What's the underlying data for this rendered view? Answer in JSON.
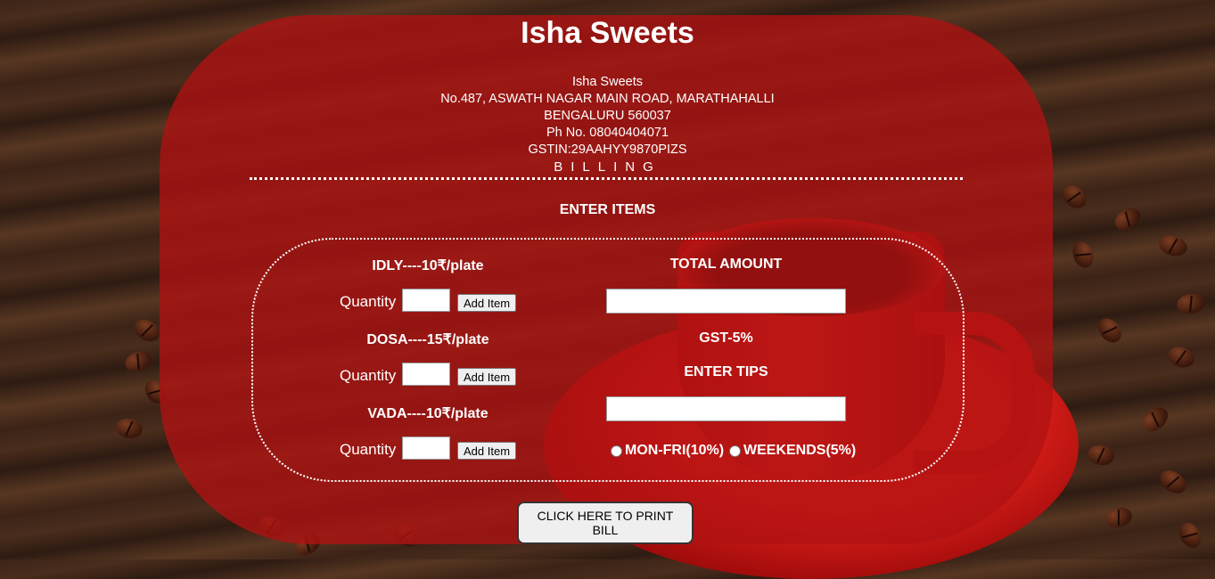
{
  "header": {
    "title": "Isha Sweets",
    "address_lines": [
      "Isha Sweets",
      "No.487, ASWATH NAGAR MAIN ROAD, MARATHAHALLI",
      "BENGALURU 560037",
      "Ph No. 08040404071",
      "GSTIN:29AAHYY9870PIZS"
    ],
    "billing": "BILLING"
  },
  "form": {
    "heading": "ENTER ITEMS",
    "items": [
      {
        "label": "IDLY----10₹/plate",
        "qty_label": "Quantity",
        "button": "Add Item"
      },
      {
        "label": "DOSA----15₹/plate",
        "qty_label": "Quantity",
        "button": "Add Item"
      },
      {
        "label": "VADA----10₹/plate",
        "qty_label": "Quantity",
        "button": "Add Item"
      }
    ],
    "total_label": "TOTAL AMOUNT",
    "gst_label": "GST-5%",
    "tips_label": "ENTER TIPS",
    "tip_options": [
      "MON-FRI(10%)",
      "WEEKENDS(5%)"
    ]
  },
  "print_button": "CLICK HERE TO PRINT BILL"
}
